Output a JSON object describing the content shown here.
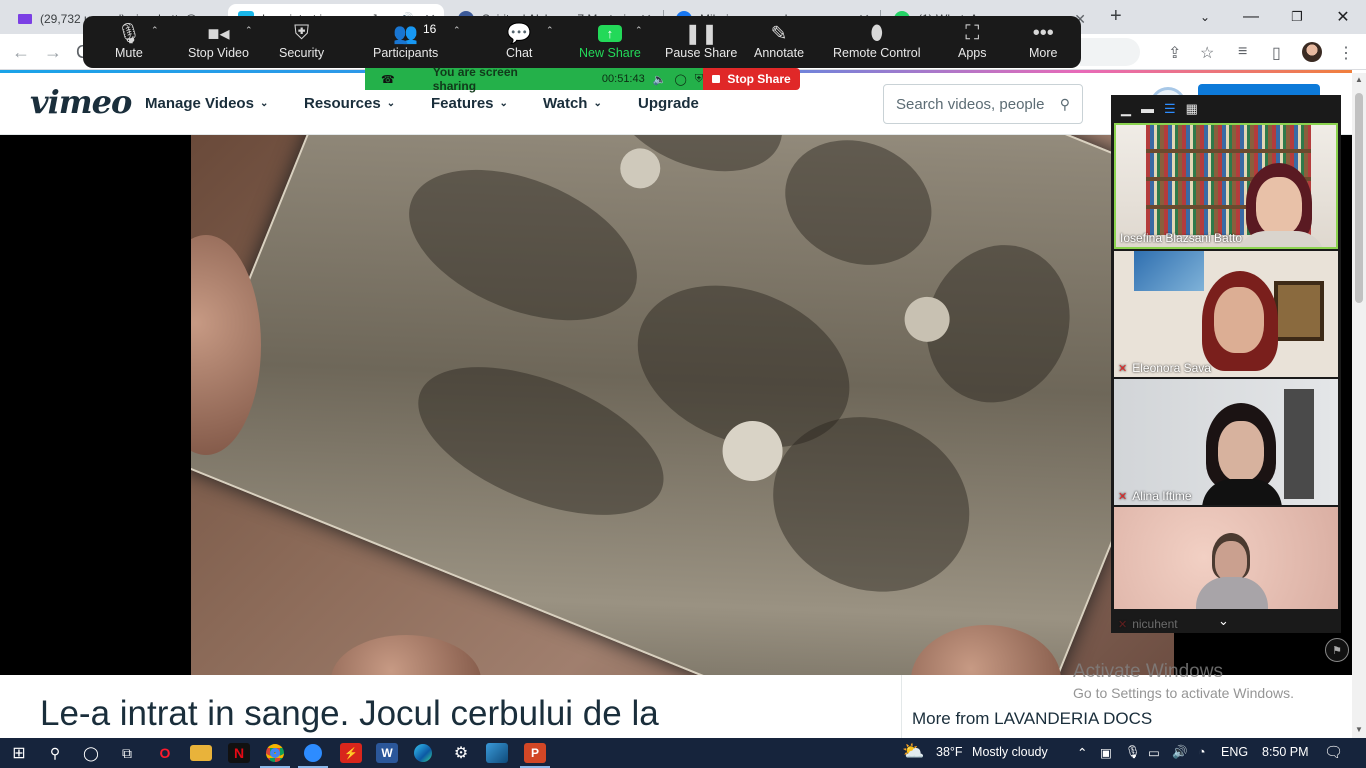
{
  "browser": {
    "tabs": [
      {
        "title": "(29,732 unread) - josebatto@",
        "icon": "mail-icon",
        "color": "#7b3fe4"
      },
      {
        "title": "Le-a intrat in sange. Joc",
        "icon": "vimeo-icon",
        "color": "#1ab7ea",
        "active": true
      },
      {
        "title": "Spiritual Alchemy 7 Mysteri",
        "icon": "globe-icon",
        "color": "#3b5998"
      },
      {
        "title": "Mihai messaged you",
        "icon": "facebook-icon",
        "color": "#1877f2"
      },
      {
        "title": "(1) WhatsApp",
        "icon": "whatsapp-icon",
        "color": "#25d366"
      }
    ],
    "new_tab": "+"
  },
  "zoom": {
    "mute": "Mute",
    "stop_video": "Stop Video",
    "security": "Security",
    "participants": "Participants",
    "participants_count": "16",
    "chat": "Chat",
    "new_share": "New Share",
    "pause_share": "Pause Share",
    "annotate": "Annotate",
    "remote_control": "Remote Control",
    "apps": "Apps",
    "more": "More",
    "sharing_status": "You are screen sharing",
    "timer": "00:51:43",
    "stop_share": "Stop Share",
    "participants_list": [
      {
        "name": "Iosefina Blazsani Batto",
        "muted": false,
        "active": true
      },
      {
        "name": "Eleonora Sava",
        "muted": true
      },
      {
        "name": "Alina Iftime",
        "muted": true
      },
      {
        "name": "nicuhent",
        "muted": true
      }
    ]
  },
  "vimeo": {
    "logo": "vimeo",
    "nav": [
      "Manage Videos",
      "Resources",
      "Features",
      "Watch",
      "Upgrade"
    ],
    "search_placeholder": "Search videos, people",
    "video_title": "Le-a intrat in sange. Jocul cerbului de la",
    "more_from": "More from LAVANDERIA DOCS"
  },
  "watermark": {
    "line1": "Activate Windows",
    "line2": "Go to Settings to activate Windows."
  },
  "taskbar": {
    "weather_temp": "38°F",
    "weather_desc": "Mostly cloudy",
    "language": "ENG",
    "time": "8:50 PM"
  }
}
